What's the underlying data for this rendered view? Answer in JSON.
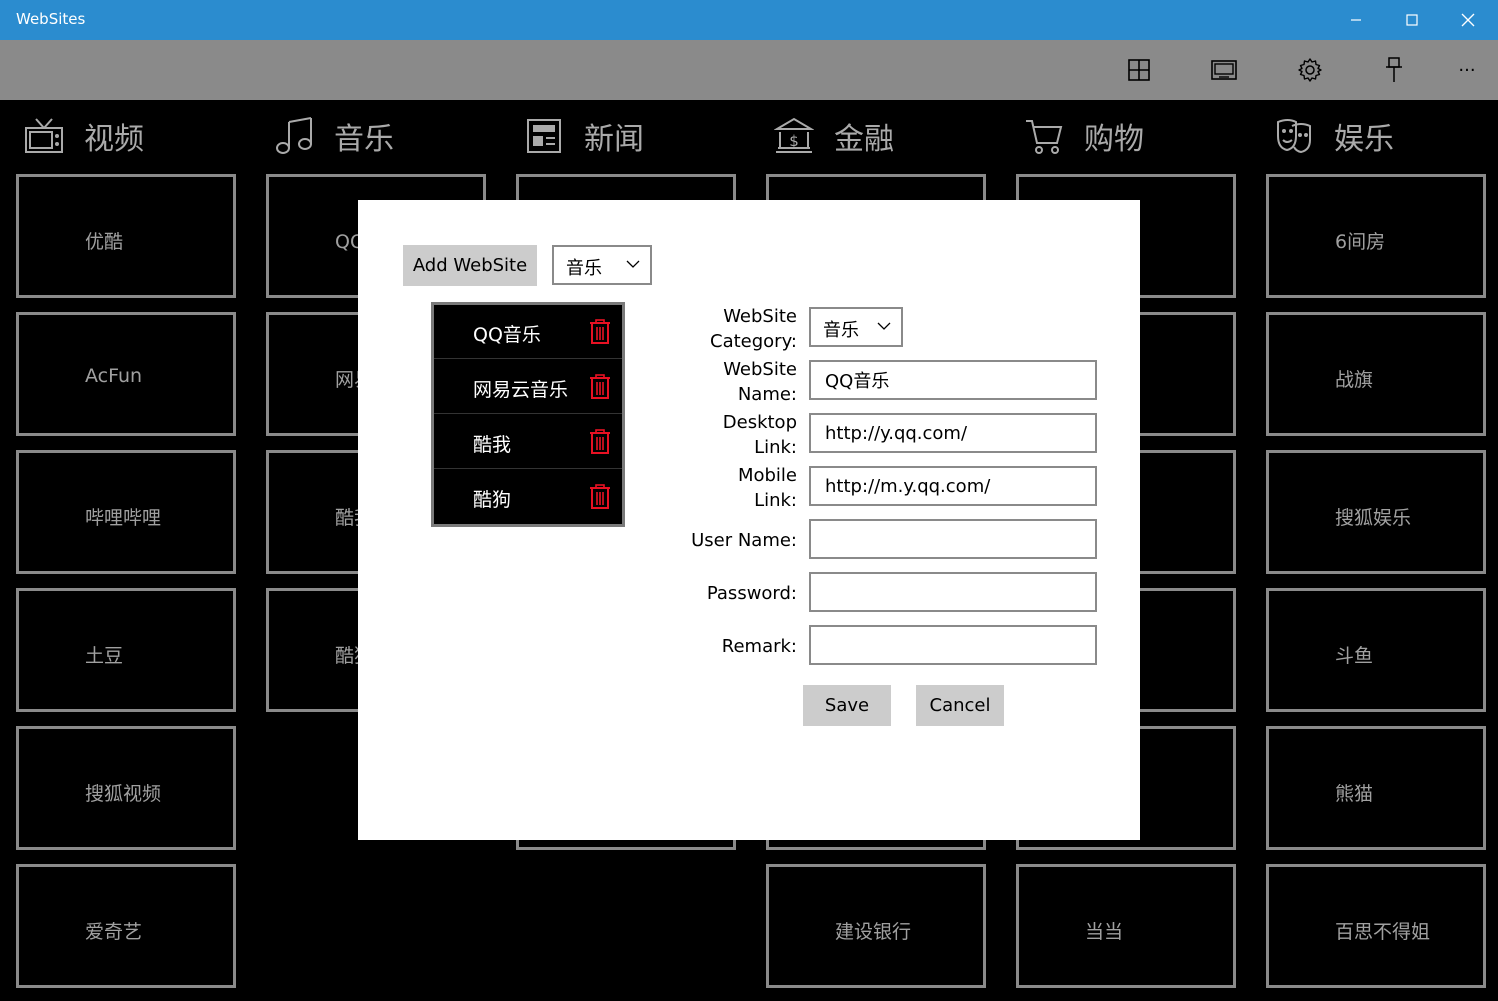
{
  "window": {
    "title": "WebSites",
    "minimize": "minimize-icon",
    "maximize": "maximize-icon",
    "close": "close-icon"
  },
  "toolbar": {
    "buttons": [
      "grid-icon",
      "tablet-icon",
      "gear-icon",
      "pin-icon",
      "more-icon"
    ],
    "more_label": "···"
  },
  "categories": [
    {
      "title": "视频",
      "icon": "tv-icon",
      "sites": [
        "优酷",
        "AcFun",
        "哔哩哔哩",
        "土豆",
        "搜狐视频",
        "爱奇艺"
      ]
    },
    {
      "title": "音乐",
      "icon": "music-icon",
      "sites": [
        "QQ音乐",
        "网易云音乐",
        "酷我",
        "酷狗"
      ]
    },
    {
      "title": "新闻",
      "icon": "newspaper-icon",
      "sites": [
        "",
        "",
        "",
        "",
        ""
      ]
    },
    {
      "title": "金融",
      "icon": "bank-icon",
      "sites": [
        "",
        "",
        "",
        "",
        "",
        "建设银行"
      ]
    },
    {
      "title": "购物",
      "icon": "cart-icon",
      "sites": [
        "",
        "",
        "",
        "",
        "",
        "当当"
      ]
    },
    {
      "title": "娱乐",
      "icon": "mask-icon",
      "sites": [
        "6间房",
        "战旗",
        "搜狐娱乐",
        "斗鱼",
        "熊猫",
        "百思不得姐"
      ]
    }
  ],
  "dialog": {
    "add_button": "Add WebSite",
    "category_filter": "音乐",
    "list": [
      {
        "name": "QQ音乐"
      },
      {
        "name": "网易云音乐"
      },
      {
        "name": "酷我"
      },
      {
        "name": "酷狗"
      }
    ],
    "delete_color": "#e81123",
    "form": {
      "category_label_1": "WebSite",
      "category_label_2": "Category:",
      "category_value": "音乐",
      "name_label_1": "WebSite",
      "name_label_2": "Name:",
      "name_value": "QQ音乐",
      "desktop_label_1": "Desktop",
      "desktop_label_2": "Link:",
      "desktop_value": "http://y.qq.com/",
      "mobile_label_1": "Mobile",
      "mobile_label_2": "Link:",
      "mobile_value": "http://m.y.qq.com/",
      "username_label": "User Name:",
      "username_value": "",
      "password_label": "Password:",
      "password_value": "",
      "remark_label": "Remark:",
      "remark_value": ""
    },
    "save_button": "Save",
    "cancel_button": "Cancel"
  },
  "colors": {
    "titlebar": "#2b8ccf",
    "cmdbar": "#8a8a8a",
    "tile_border": "#8a8a8a",
    "category_text": "#aaaaaa"
  }
}
